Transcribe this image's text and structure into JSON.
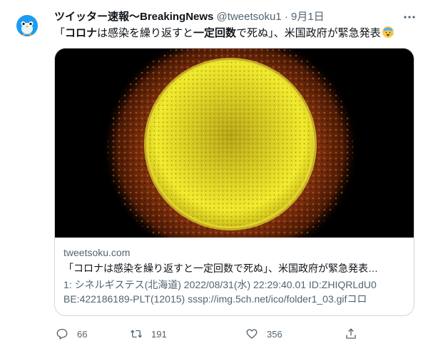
{
  "tweet": {
    "author_name": "ツイッター速報〜BreakingNews",
    "handle": "@tweetsoku1",
    "separator": "·",
    "date": "9月1日",
    "text_part1": "「",
    "text_bold1": "コロナ",
    "text_part2": "は感染を繰り返すと",
    "text_bold2": "一定回数",
    "text_part3": "で死ぬ」、米国政府が緊急発表",
    "emoji": "anxious-face-with-sweat"
  },
  "card": {
    "domain": "tweetsoku.com",
    "title": "「コロナは感染を繰り返すと一定回数で死ぬ」、米国政府が緊急発表…",
    "description_line1": "1: シネルギステス(北海道) 2022/08/31(水) 22:29:40.01 ID:ZHIQRLdU0",
    "description_line2": "BE:422186189-PLT(12015) sssp://img.5ch.net/ico/folder1_03.gifコロ"
  },
  "actions": {
    "reply_count": "66",
    "retweet_count": "191",
    "like_count": "356"
  },
  "colors": {
    "muted": "#536471",
    "border": "#cfd9de",
    "avatar_bird": "#1d9bf0"
  }
}
